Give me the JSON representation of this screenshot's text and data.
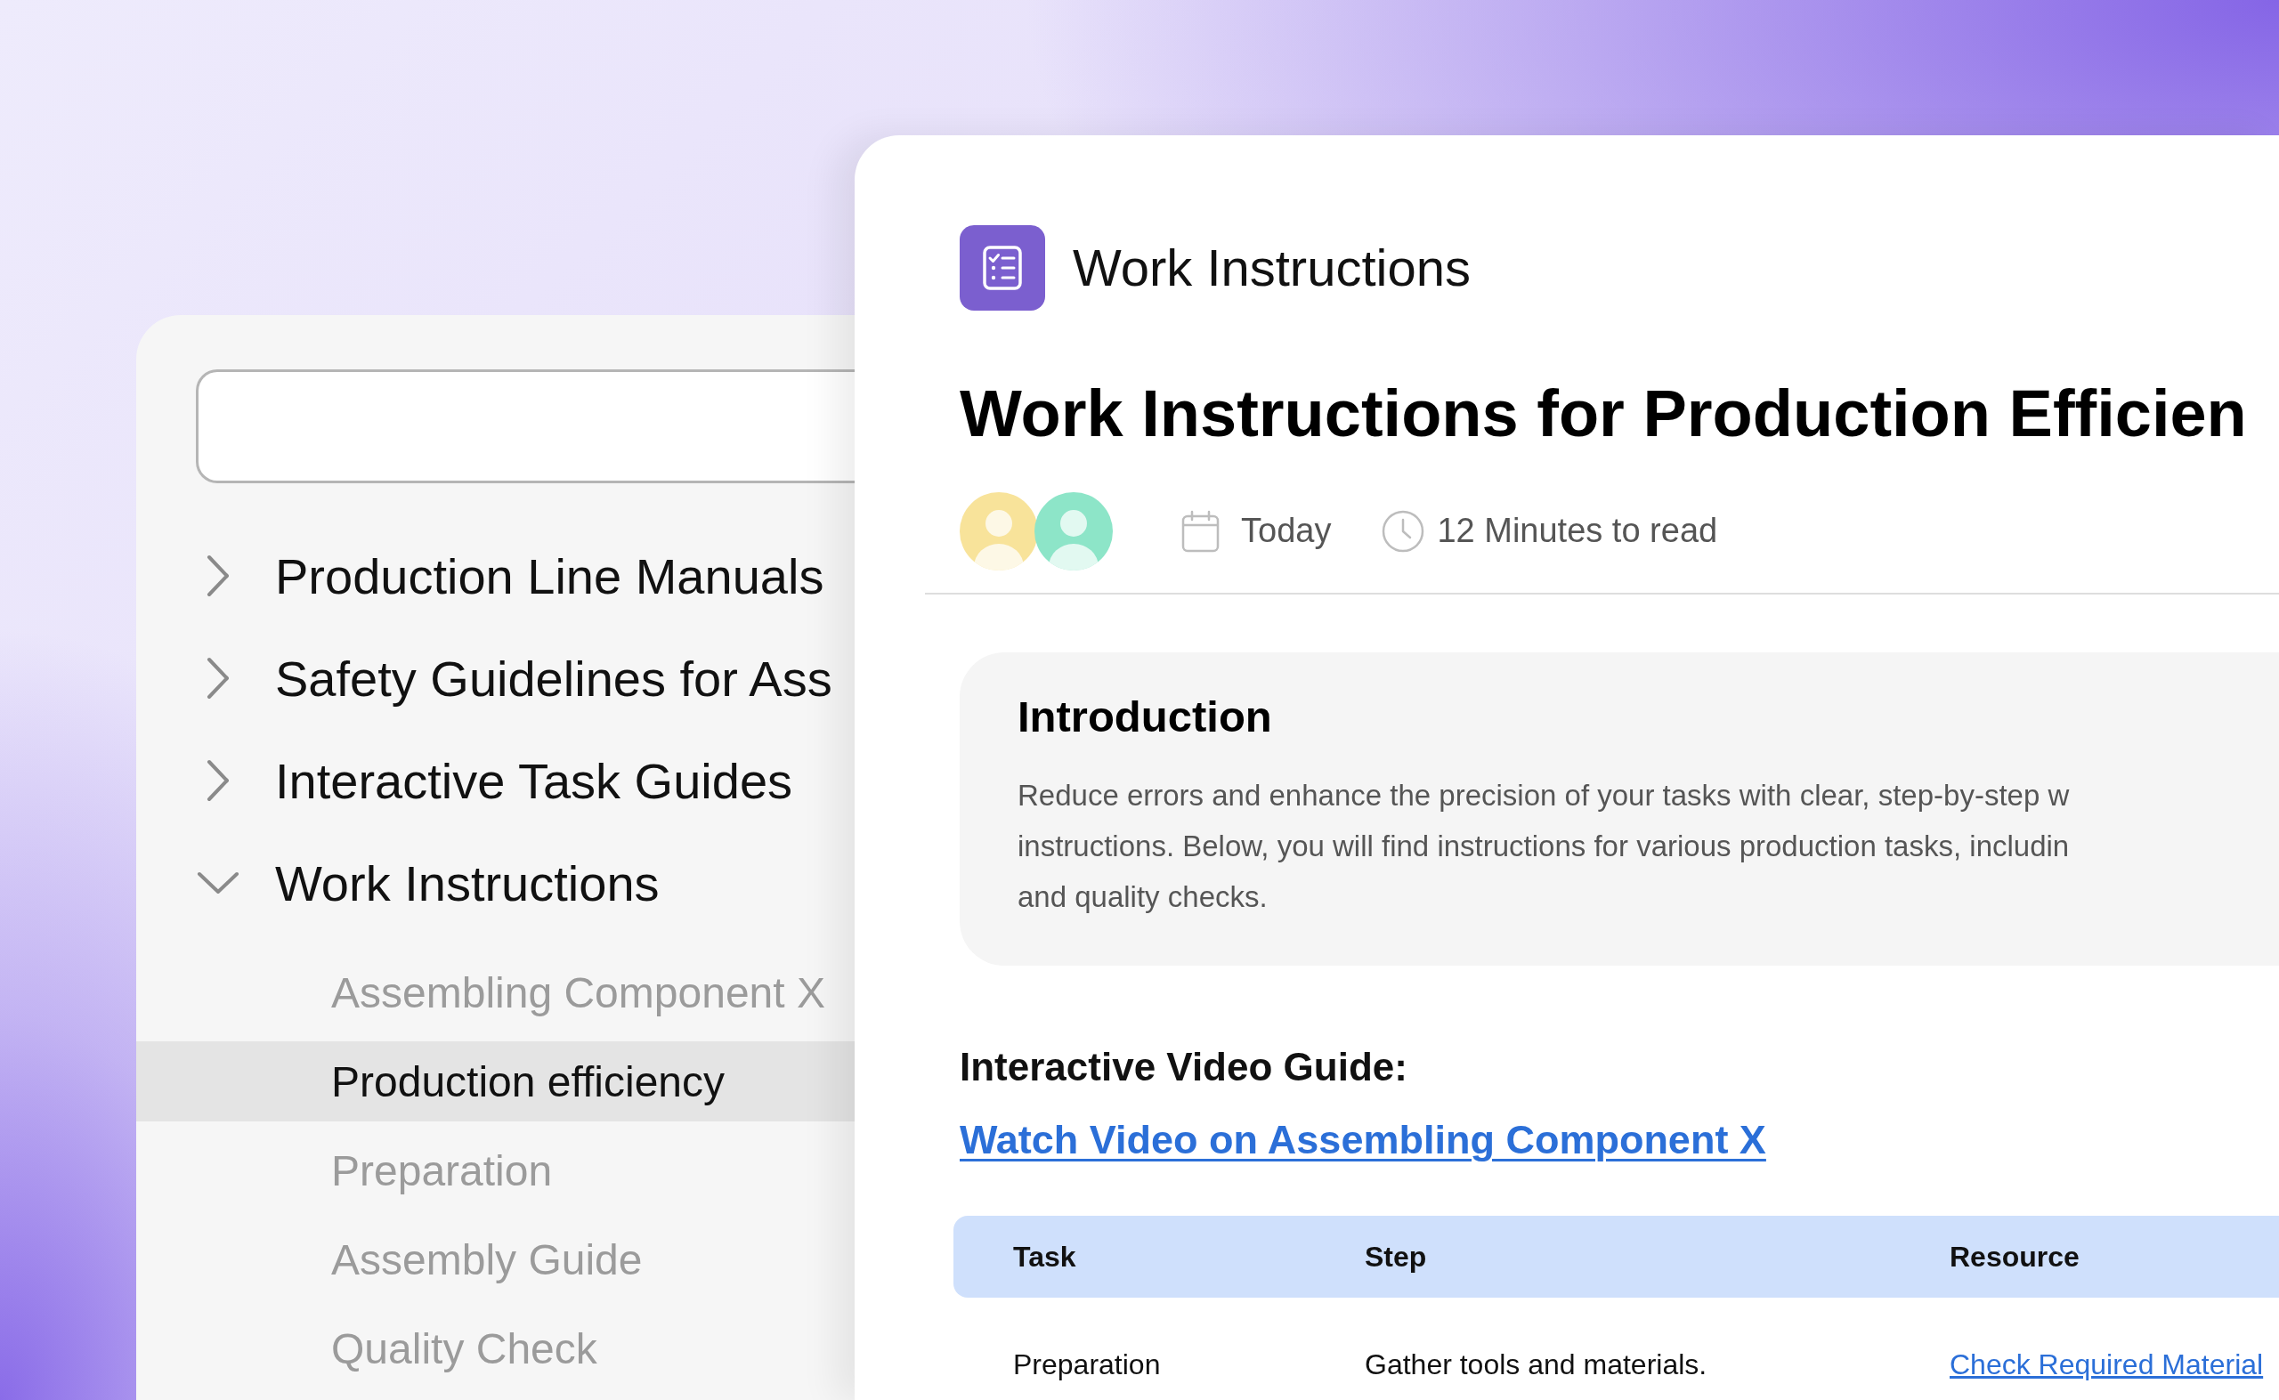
{
  "sidebar": {
    "items": [
      {
        "label": "Production Line Manuals",
        "expanded": false
      },
      {
        "label": "Safety Guidelines for Ass",
        "expanded": false
      },
      {
        "label": "Interactive Task Guides",
        "expanded": false
      },
      {
        "label": "Work Instructions",
        "expanded": true,
        "children": [
          {
            "label": "Assembling Component X",
            "selected": false
          },
          {
            "label": "Production efficiency",
            "selected": true
          },
          {
            "label": "Preparation",
            "selected": false
          },
          {
            "label": "Assembly Guide",
            "selected": false
          },
          {
            "label": "Quality Check",
            "selected": false
          }
        ]
      }
    ]
  },
  "header": {
    "title": "Work Instructions"
  },
  "document": {
    "title": "Work Instructions for Production Efficien",
    "meta": {
      "avatars": [
        {
          "color": "#f8e39a"
        },
        {
          "color": "#8de5c8"
        }
      ],
      "date": "Today",
      "read_time": "12 Minutes to read"
    },
    "introduction": {
      "heading": "Introduction",
      "lines": [
        "Reduce errors and enhance the precision of your tasks with clear, step-by-step w",
        "instructions. Below, you will find instructions for various production tasks, includin",
        "and quality checks."
      ]
    },
    "video_guide": {
      "heading": "Interactive Video Guide:",
      "link": "Watch Video on Assembling Component X"
    },
    "table": {
      "columns": [
        "Task",
        "Step",
        "Resource"
      ],
      "rows": [
        {
          "cells": [
            {
              "kind": "text",
              "text": "Preparation"
            },
            {
              "kind": "text",
              "text": "Gather tools and materials."
            },
            {
              "kind": "link",
              "text": "Check Required Material"
            }
          ]
        }
      ]
    }
  }
}
